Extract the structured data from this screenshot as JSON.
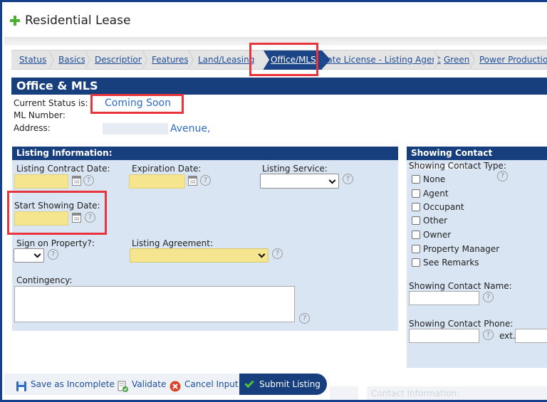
{
  "header": {
    "title": "Residential Lease"
  },
  "tabs": [
    {
      "label": "Status"
    },
    {
      "label": "Basics"
    },
    {
      "label": "Description"
    },
    {
      "label": "Features"
    },
    {
      "label": "Land/Leasing"
    },
    {
      "label": "Office/MLS",
      "active": true
    },
    {
      "label": "State License - Listing Agent"
    },
    {
      "label": "Green"
    },
    {
      "label": "Power Production"
    }
  ],
  "office": {
    "title": "Office & MLS",
    "status_label": "Current Status is:",
    "status_value": "Coming Soon",
    "ml_label": "ML Number:",
    "address_label": "Address:",
    "address_value": "Avenue,"
  },
  "listing": {
    "title": "Listing Information:",
    "contract_date_label": "Listing Contract Date:",
    "expiration_label": "Expiration Date:",
    "service_label": "Listing Service:",
    "start_showing_label": "Start Showing Date:",
    "sign_label": "Sign on Property?:",
    "agreement_label": "Listing Agreement:",
    "contingency_label": "Contingency:"
  },
  "showing": {
    "title": "Showing Contact Information:",
    "type_label": "Showing Contact Type:",
    "types": [
      "None",
      "Agent",
      "Occupant",
      "Other",
      "Owner",
      "Property Manager",
      "See Remarks"
    ],
    "name_label": "Showing Contact Name:",
    "phone_label": "Showing Contact Phone:",
    "ext_label": "ext."
  },
  "toolbar": {
    "save_label": "Save as Incomplete",
    "validate_label": "Validate",
    "cancel_label": "Cancel Input",
    "submit_label": "Submit Listing"
  },
  "footer": {
    "contact_label": "Contact Information:"
  },
  "colors": {
    "brand": "#173f7e",
    "highlight": "#e8343c",
    "panel": "#d9e5f3",
    "required": "#f5e58f",
    "link": "#1f4e99"
  }
}
